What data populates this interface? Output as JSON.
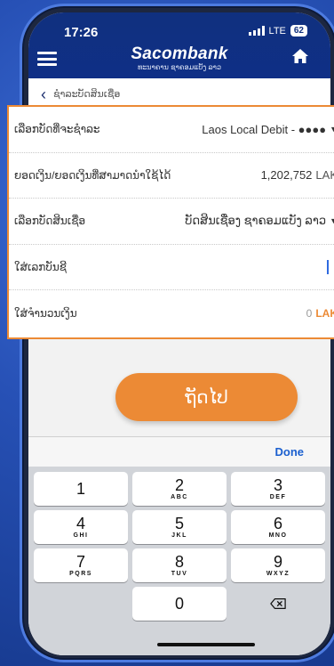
{
  "status": {
    "time": "17:26",
    "network": "LTE",
    "battery": "62"
  },
  "header": {
    "brand": "Sacombank",
    "brand_sub": "ທະນາຄານ ຊາຄອມແບັງ ລາວ"
  },
  "subheader": {
    "title": "ຊໍາລະບັດສິນເຊື່ອ"
  },
  "form": {
    "rows": [
      {
        "label": "ເລືອກບັດທີ່ຈະຊໍາລະ",
        "value": "Laos Local Debit - ●●●● "
      },
      {
        "label": "ຍອດເງິນ/ຍອດເງິນທີ່ສາມາດນໍາໃຊ້ໄດ້",
        "value": "1,202,752",
        "unit": "LAK"
      },
      {
        "label": "ເລືອກບັດສິນເຊື່ອ",
        "value": "ບັດສິນເຊື່ອງ ຊາຄອມແບັງ ລາວ"
      },
      {
        "label": "ໃສ່ເລກບັນຊີ",
        "value": ""
      },
      {
        "label": "ໃສ່ຈໍານວນເງິນ",
        "value": "0",
        "unit": "LAK"
      }
    ]
  },
  "actions": {
    "continue_label": "ຖັດໄປ"
  },
  "keyboard": {
    "done_label": "Done",
    "keys": [
      {
        "num": "1",
        "letters": ""
      },
      {
        "num": "2",
        "letters": "ABC"
      },
      {
        "num": "3",
        "letters": "DEF"
      },
      {
        "num": "4",
        "letters": "GHI"
      },
      {
        "num": "5",
        "letters": "JKL"
      },
      {
        "num": "6",
        "letters": "MNO"
      },
      {
        "num": "7",
        "letters": "PQRS"
      },
      {
        "num": "8",
        "letters": "TUV"
      },
      {
        "num": "9",
        "letters": "WXYZ"
      },
      {
        "num": "0",
        "letters": ""
      }
    ]
  },
  "colors": {
    "brand_blue": "#0f2f86",
    "accent_orange": "#ec8a35",
    "link_blue": "#1a5fcf"
  }
}
